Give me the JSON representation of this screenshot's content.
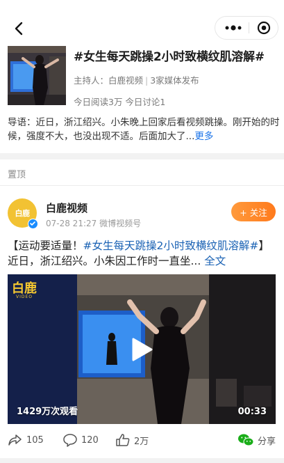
{
  "navbar": {
    "back_icon": "chevron-left-icon",
    "more_icon": "more-dots-icon",
    "close_icon": "target-close-icon"
  },
  "topic": {
    "title": "#女生每天跳操2小时致横纹肌溶解#",
    "host_label": "主持人：白鹿视频",
    "media_label": "3家媒体发布",
    "stats": "今日阅读3万 今日讨论1",
    "intro": "导语：近日，浙江绍兴。小朱晚上回家后看视频跳操。刚开始的时候，强度不大，也没出现不适。后面加大了...",
    "more_link": "更多"
  },
  "section": {
    "pinned_label": "置顶"
  },
  "post": {
    "avatar_text": "白鹿",
    "author": "白鹿视频",
    "meta": "07-28 21:27  微博视频号",
    "follow_label": "+ 关注",
    "text_prefix": "【运动要适量！",
    "topic_tag": "#女生每天跳操2小时致横纹肌溶解#",
    "text_suffix": "】近日，浙江绍兴。小朱因工作时一直坐... ",
    "fulltext_link": "全文",
    "video": {
      "logo_text": "白鹿",
      "logo_sub": "VIDEO",
      "views": "1429万次观看",
      "duration": "00:33"
    },
    "actions": {
      "repost": "105",
      "comment": "120",
      "like": "2万",
      "share": "分享"
    }
  },
  "colors": {
    "accent_link": "#1a62b4",
    "follow": "#ff7a1c",
    "avatar": "#f2c233",
    "wechat_green": "#1aad19"
  }
}
